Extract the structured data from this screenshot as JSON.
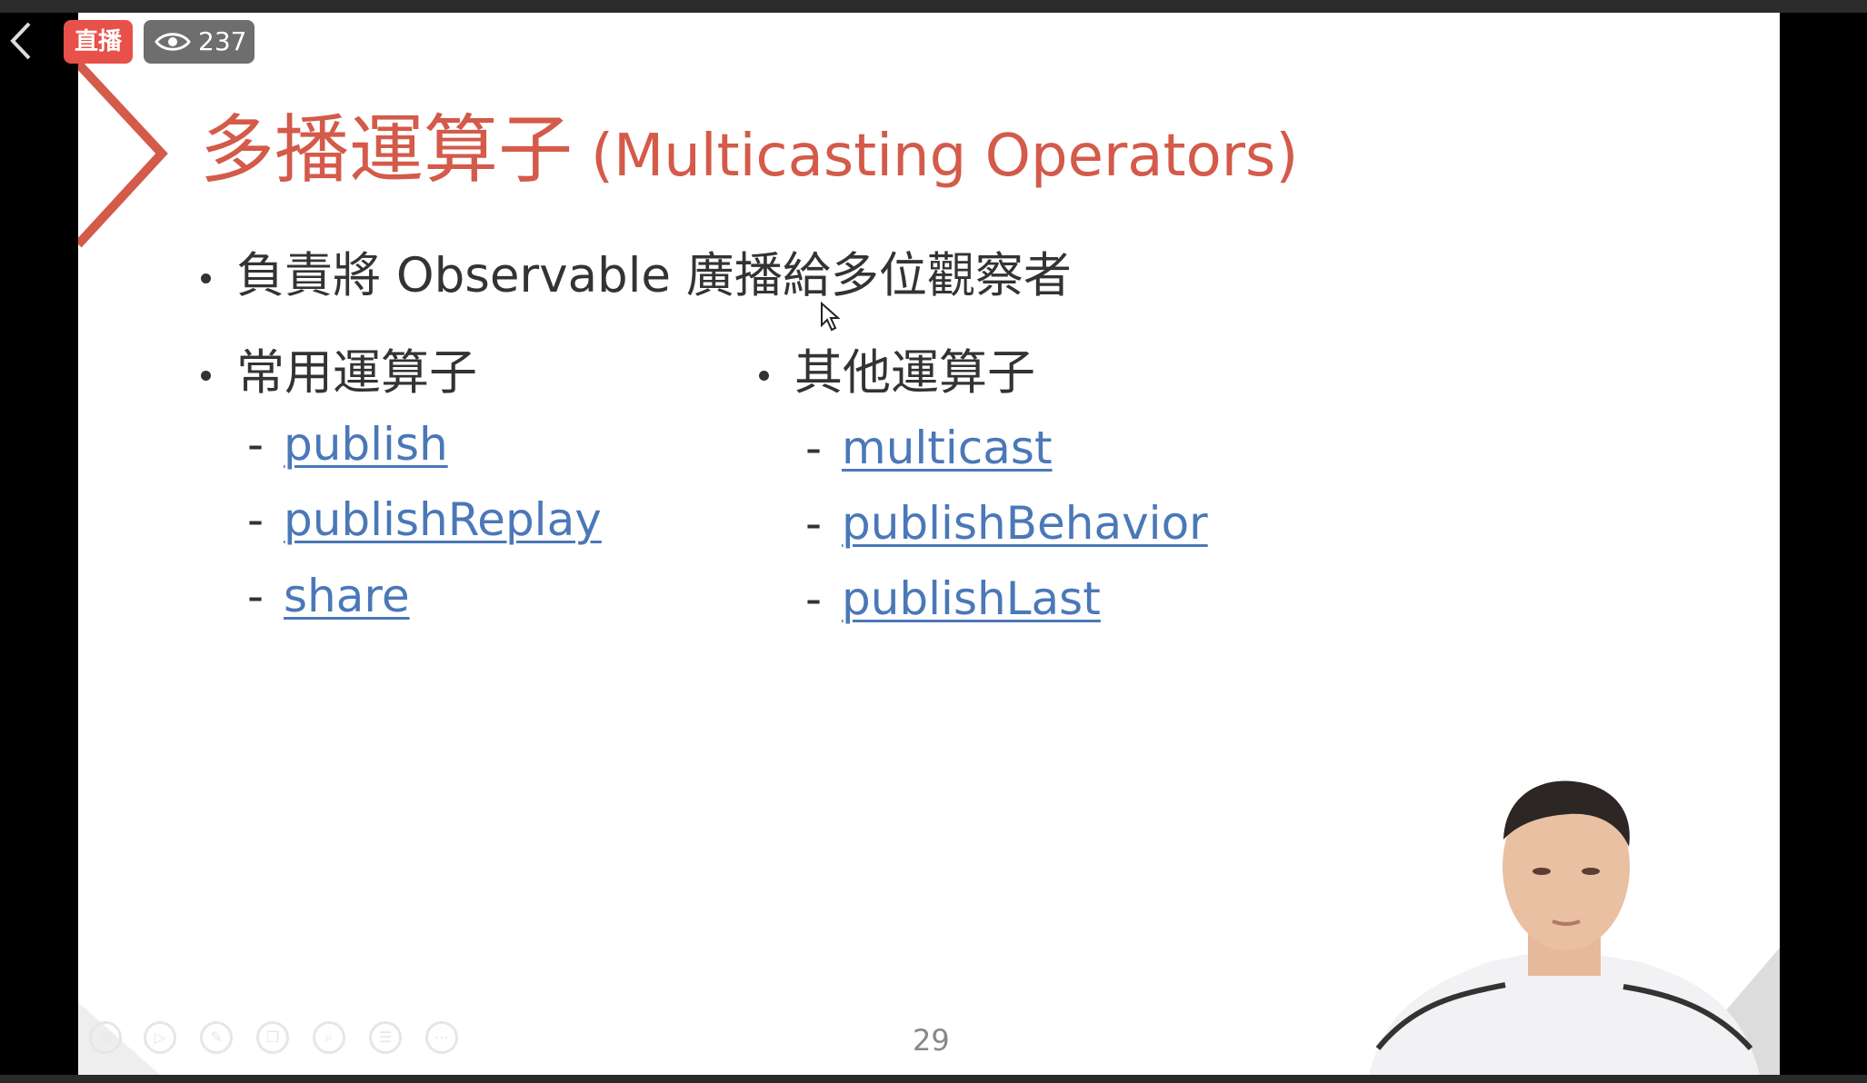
{
  "stream": {
    "live_label": "直播",
    "viewer_count": "237"
  },
  "slide": {
    "title_zh": "多播運算子",
    "title_en": "(Multicasting Operators)",
    "bullet1": "負責將 Observable 廣播給多位觀察者",
    "bullet_common": "常用運算子",
    "bullet_other": "其他運算子",
    "common_ops": [
      "publish",
      "publishReplay",
      "share"
    ],
    "other_ops": [
      "multicast",
      "publishBehavior",
      "publishLast"
    ],
    "dash": "-",
    "page_number": "29"
  },
  "colors": {
    "title": "#d45a4a",
    "link": "#4a78b8",
    "live_badge": "#e8504a"
  },
  "icons": [
    "back-arrow-icon",
    "eye-icon",
    "cursor-icon",
    "play-icon",
    "pen-icon",
    "copy-icon",
    "zoom-icon",
    "menu-icon",
    "more-icon"
  ]
}
